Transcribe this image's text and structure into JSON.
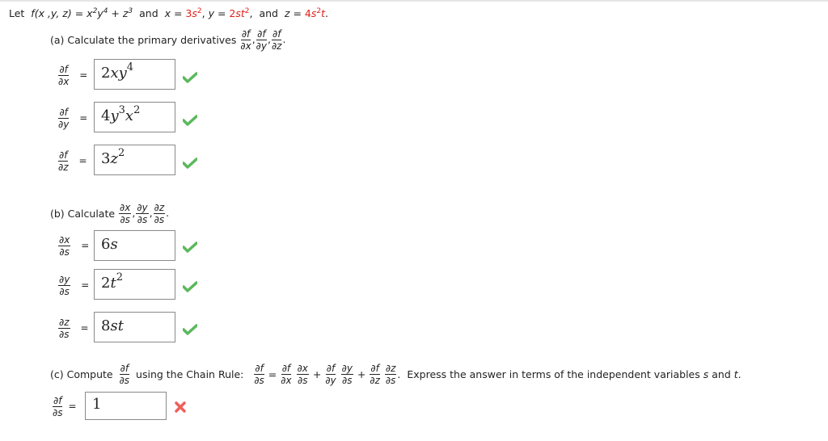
{
  "problem": {
    "let": "Let",
    "function_def": "f(x ,y, z) = x²y⁴ + z³",
    "and1": "and",
    "x_def_lhs": "x = ",
    "x_def_rhs": "3s²",
    "y_def_lhs": "y = ",
    "y_def_rhs": "2st²",
    "and2": "and",
    "z_def_lhs": "z = ",
    "z_def_rhs": "4s²t",
    "period": "."
  },
  "part_a": {
    "prompt": "(a) Calculate the primary derivatives",
    "derivatives": [
      {
        "num": "∂f",
        "den": "∂x",
        "answer": "2xy⁴",
        "status": "correct"
      },
      {
        "num": "∂f",
        "den": "∂y",
        "answer": "4y³x²",
        "status": "correct"
      },
      {
        "num": "∂f",
        "den": "∂z",
        "answer": "3z²",
        "status": "correct"
      }
    ]
  },
  "part_b": {
    "prompt": "(b) Calculate",
    "derivatives": [
      {
        "num": "∂x",
        "den": "∂s",
        "answer": "6s",
        "status": "correct"
      },
      {
        "num": "∂y",
        "den": "∂s",
        "answer": "2t²",
        "status": "correct"
      },
      {
        "num": "∂z",
        "den": "∂s",
        "answer": "8st",
        "status": "correct"
      }
    ]
  },
  "part_c": {
    "prompt": "(c) Compute",
    "middle": "using the Chain Rule:",
    "suffix": "Express the answer in terms of the independent variables",
    "var_s": "s",
    "and": "and",
    "var_t": "t",
    "period": ".",
    "lhs_num": "∂f",
    "lhs_den": "∂s",
    "answer": "1",
    "status": "incorrect"
  },
  "colors": {
    "accent_red": "#e0211b",
    "correct_green": "#5cb85c",
    "incorrect_red": "#ee5f5b"
  },
  "symbols": {
    "equals": "=",
    "plus": "+",
    "comma": ",",
    "dot": "."
  }
}
